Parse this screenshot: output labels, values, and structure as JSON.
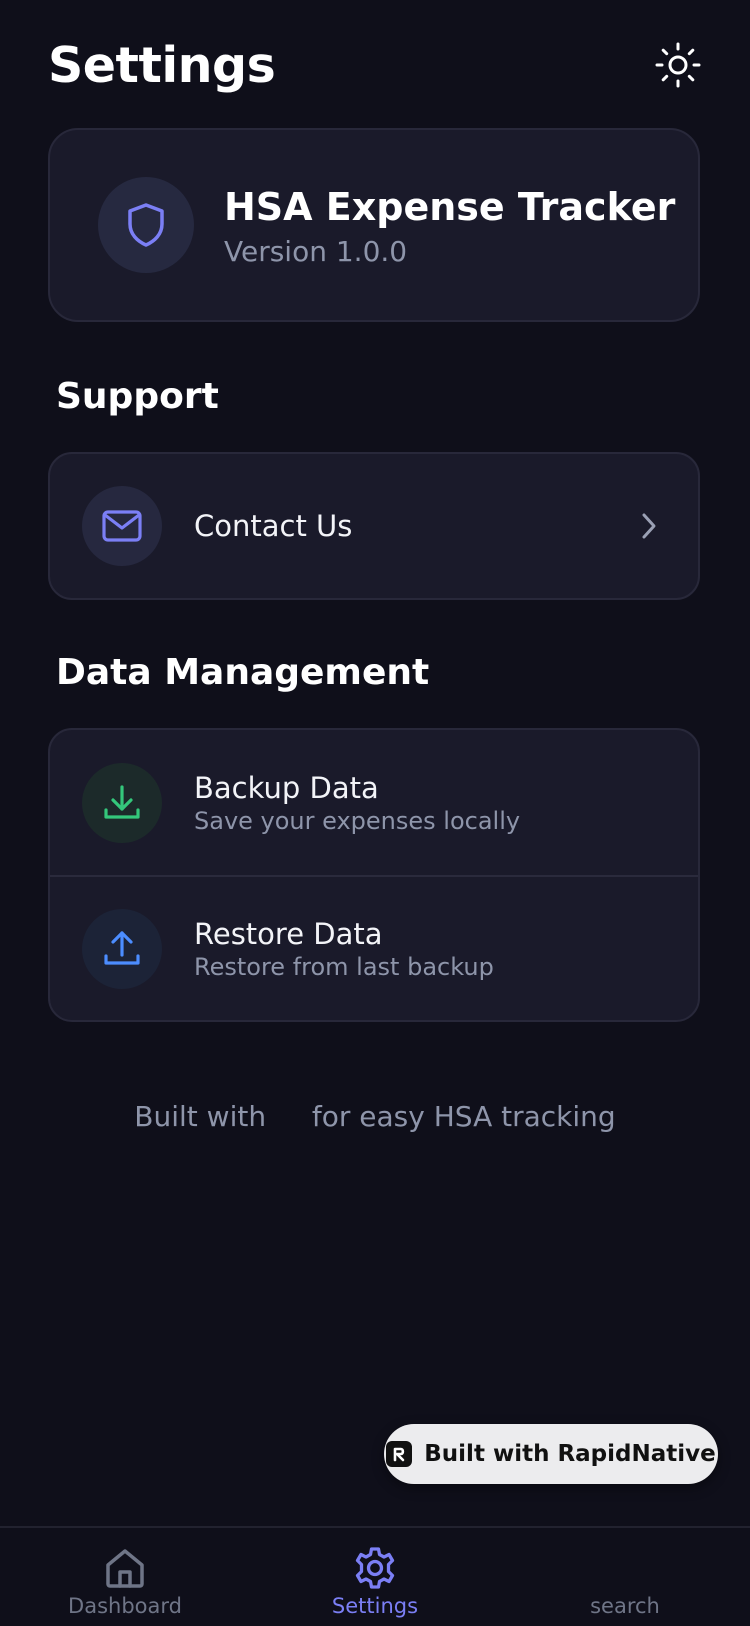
{
  "header": {
    "title": "Settings",
    "theme_icon": "sun-icon"
  },
  "app_info": {
    "name": "HSA Expense Tracker",
    "version": "Version 1.0.0",
    "icon": "shield-icon"
  },
  "support": {
    "title": "Support",
    "items": [
      {
        "label": "Contact Us",
        "icon": "mail-icon"
      }
    ]
  },
  "data_management": {
    "title": "Data Management",
    "items": [
      {
        "label": "Backup Data",
        "subtitle": "Save your expenses locally",
        "icon": "download-icon"
      },
      {
        "label": "Restore Data",
        "subtitle": "Restore from last backup",
        "icon": "upload-icon"
      }
    ]
  },
  "footer": {
    "prefix": "Built with",
    "suffix": "for easy HSA tracking"
  },
  "badge": {
    "label": "Built with RapidNative"
  },
  "tabs": [
    {
      "label": "Dashboard",
      "icon": "home-icon"
    },
    {
      "label": "Settings",
      "icon": "gear-icon",
      "active": true
    },
    {
      "label": "search"
    }
  ],
  "colors": {
    "background": "#0f0f1a",
    "card": "#1a1a2a",
    "accent": "#7b7ff5",
    "green": "#34c77b",
    "blue": "#4c8dff",
    "muted_text": "#8e95aa"
  }
}
